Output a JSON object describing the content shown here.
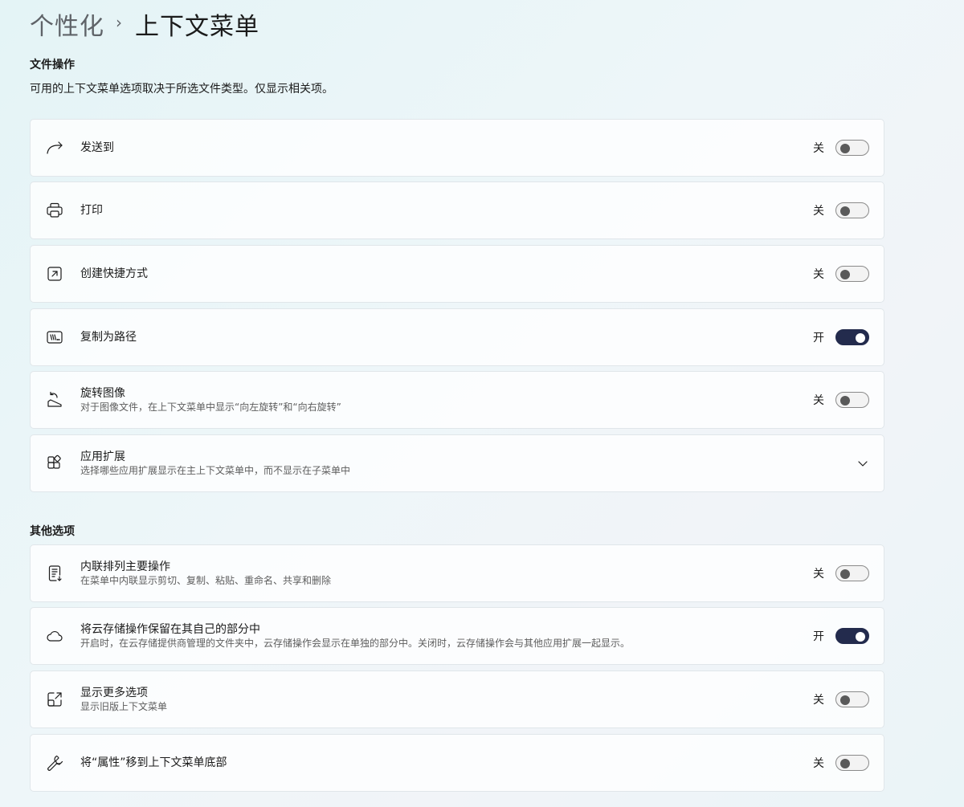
{
  "breadcrumb": {
    "parent": "个性化",
    "separator": "›",
    "current": "上下文菜单"
  },
  "file_ops": {
    "title": "文件操作",
    "description": "可用的上下文菜单选项取决于所选文件类型。仅显示相关项。",
    "items": [
      {
        "icon": "share-arrow-icon",
        "title": "发送到",
        "subtitle": "",
        "state": "关",
        "on": false
      },
      {
        "icon": "printer-icon",
        "title": "打印",
        "subtitle": "",
        "state": "关",
        "on": false
      },
      {
        "icon": "shortcut-icon",
        "title": "创建快捷方式",
        "subtitle": "",
        "state": "关",
        "on": false
      },
      {
        "icon": "copy-path-icon",
        "title": "复制为路径",
        "subtitle": "",
        "state": "开",
        "on": true
      },
      {
        "icon": "rotate-image-icon",
        "title": "旋转图像",
        "subtitle": "对于图像文件，在上下文菜单中显示“向左旋转”和“向右旋转”",
        "state": "关",
        "on": false
      },
      {
        "icon": "app-extensions-icon",
        "title": "应用扩展",
        "subtitle": "选择哪些应用扩展显示在主上下文菜单中，而不显示在子菜单中",
        "expandable": true
      }
    ]
  },
  "other_options": {
    "title": "其他选项",
    "items": [
      {
        "icon": "inline-actions-icon",
        "title": "内联排列主要操作",
        "subtitle": "在菜单中内联显示剪切、复制、粘贴、重命名、共享和删除",
        "state": "关",
        "on": false
      },
      {
        "icon": "cloud-icon",
        "title": "将云存储操作保留在其自己的部分中",
        "subtitle": "开启时，在云存储提供商管理的文件夹中，云存储操作会显示在单独的部分中。关闭时，云存储操作会与其他应用扩展一起显示。",
        "state": "开",
        "on": true
      },
      {
        "icon": "show-more-icon",
        "title": "显示更多选项",
        "subtitle": "显示旧版上下文菜单",
        "state": "关",
        "on": false
      },
      {
        "icon": "wrench-icon",
        "title": "将“属性”移到上下文菜单底部",
        "subtitle": "",
        "state": "关",
        "on": false
      }
    ]
  },
  "colors": {
    "toggle_on": "#232b4d",
    "text_primary": "#1b1b1b",
    "text_secondary": "#5d5d5d"
  }
}
